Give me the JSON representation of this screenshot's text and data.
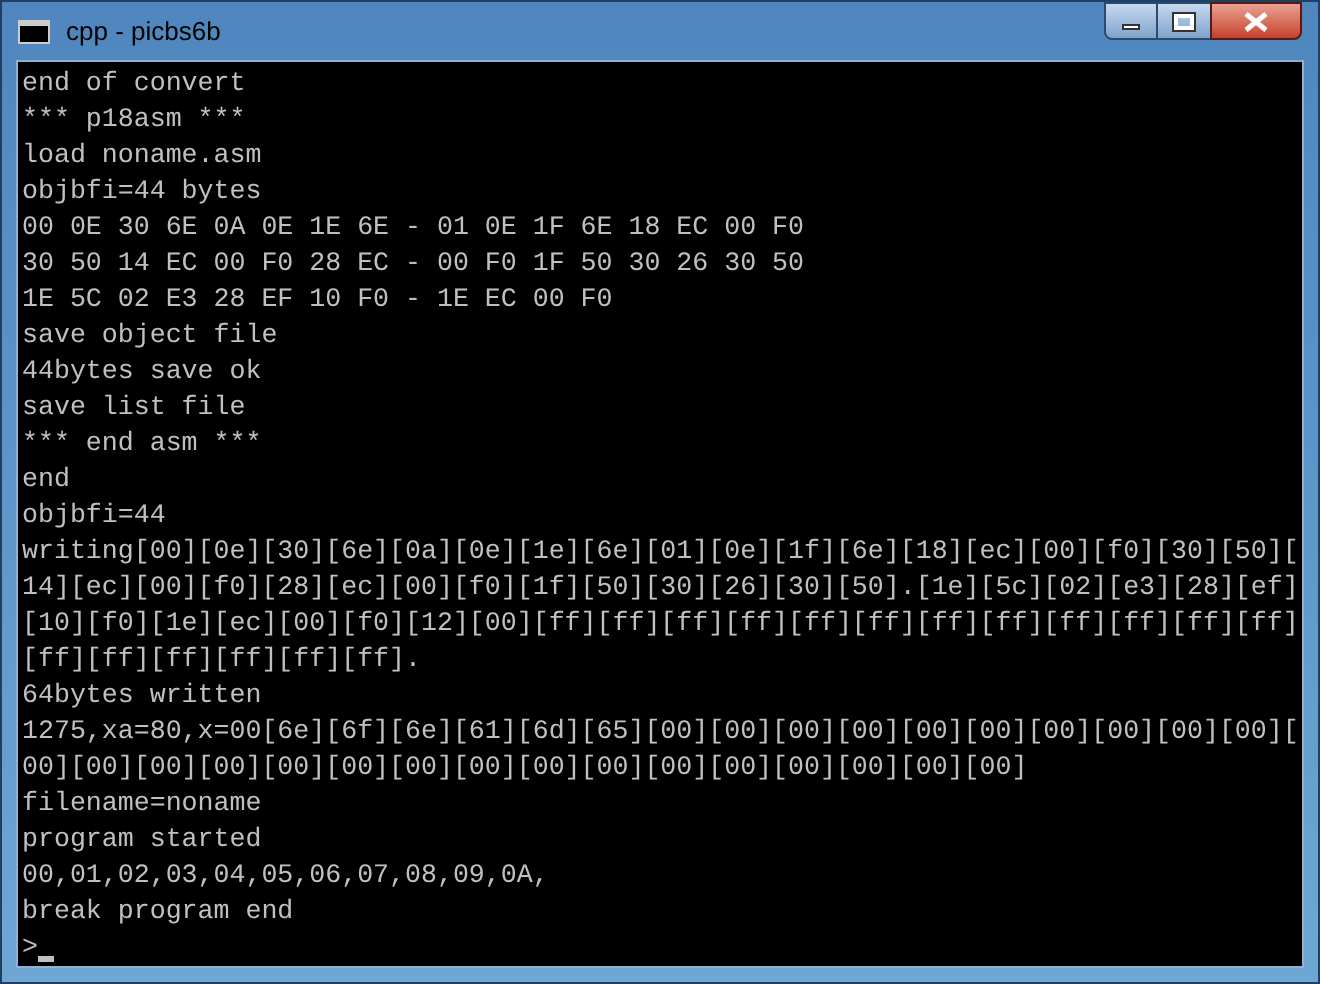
{
  "window": {
    "title": "cpp - picbs6b"
  },
  "console": {
    "lines": [
      "end of convert",
      "*** p18asm ***",
      "load noname.asm",
      "objbfi=44 bytes",
      "00 0E 30 6E 0A 0E 1E 6E - 01 0E 1F 6E 18 EC 00 F0",
      "30 50 14 EC 00 F0 28 EC - 00 F0 1F 50 30 26 30 50",
      "1E 5C 02 E3 28 EF 10 F0 - 1E EC 00 F0",
      "save object file",
      "44bytes save ok",
      "save list file",
      "*** end asm ***",
      "end",
      "objbfi=44",
      "writing[00][0e][30][6e][0a][0e][1e][6e][01][0e][1f][6e][18][ec][00][f0][30][50][",
      "14][ec][00][f0][28][ec][00][f0][1f][50][30][26][30][50].[1e][5c][02][e3][28][ef]",
      "[10][f0][1e][ec][00][f0][12][00][ff][ff][ff][ff][ff][ff][ff][ff][ff][ff][ff][ff]",
      "[ff][ff][ff][ff][ff][ff].",
      "64bytes written",
      "1275,xa=80,x=00[6e][6f][6e][61][6d][65][00][00][00][00][00][00][00][00][00][00][",
      "00][00][00][00][00][00][00][00][00][00][00][00][00][00][00][00]",
      "filename=noname",
      "program started",
      "00,01,02,03,04,05,06,07,08,09,0A,",
      "break program end"
    ],
    "prompt": ">"
  }
}
